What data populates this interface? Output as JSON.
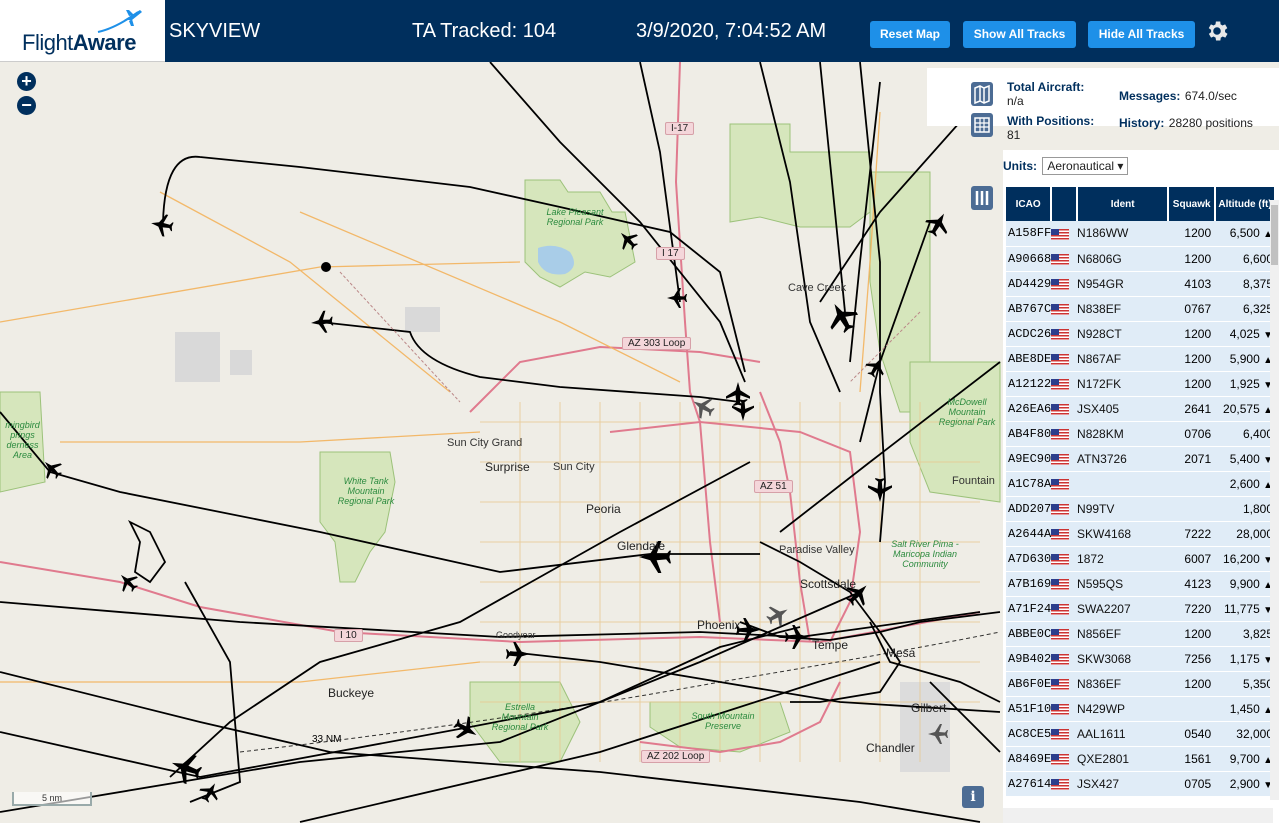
{
  "header": {
    "logo_text_light": "Flight",
    "logo_text_bold": "Aware",
    "title": "SKYVIEW",
    "tracked": "TA Tracked: 104",
    "datetime": "3/9/2020, 7:04:52 AM",
    "buttons": {
      "reset": "Reset Map",
      "show_all": "Show All Tracks",
      "hide_all": "Hide All Tracks"
    }
  },
  "map": {
    "zoom_in": "+",
    "zoom_out": "−",
    "scale": "5 nm",
    "range_ring": "33 NM",
    "labels": {
      "cave_creek": "Cave Creek",
      "sun_city_grand": "Sun City Grand",
      "surprise": "Surprise",
      "sun_city": "Sun City",
      "peoria": "Peoria",
      "glendale": "Glendale",
      "paradise_valley": "Paradise Valley",
      "scottsdale": "Scottsdale",
      "phoenix": "Phoenix",
      "tempe": "Tempe",
      "mesa": "Mesa",
      "goodyear": "Goodyear",
      "buckeye": "Buckeye",
      "gilbert": "Gilbert",
      "chandler": "Chandler",
      "fountain": "Fountain"
    },
    "parks": {
      "lake_pleasant": "Lake Pleasant Regional Park",
      "white_tank": "White Tank Mountain Regional Park",
      "mcdowell": "McDowell Mountain Regional Park",
      "estrella": "Estrella Mountain Regional Park",
      "south_mountain": "South Mountain Preserve",
      "salt_river": "Salt River Pima - Maricopa Indian Community",
      "hummingbird": "mingbird prings derness Area"
    },
    "roads": {
      "i17_top": "I-17",
      "i17": "I 17",
      "az303": "AZ 303 Loop",
      "az51": "AZ 51",
      "i10": "I 10",
      "az202": "AZ 202 Loop"
    }
  },
  "stats": {
    "total_aircraft_label": "Total Aircraft:",
    "total_aircraft_value": "n/a",
    "with_positions_label": "With Positions:",
    "with_positions_value": "81",
    "messages_label": "Messages:",
    "messages_value": "674.0/sec",
    "history_label": "History:",
    "history_value": "28280 positions"
  },
  "table": {
    "units_label": "Units:",
    "units_value": "Aeronautical",
    "columns": [
      "ICAO",
      "",
      "Ident",
      "Squawk",
      "Altitude (ft)"
    ],
    "rows": [
      {
        "icao": "A158FF",
        "ident": "N186WW",
        "squawk": "1200",
        "alt": "6,500",
        "trend": "▲"
      },
      {
        "icao": "A90668",
        "ident": "N6806G",
        "squawk": "1200",
        "alt": "6,600",
        "trend": ""
      },
      {
        "icao": "AD4429",
        "ident": "N954GR",
        "squawk": "4103",
        "alt": "8,375",
        "trend": ""
      },
      {
        "icao": "AB767C",
        "ident": "N838EF",
        "squawk": "0767",
        "alt": "6,325",
        "trend": ""
      },
      {
        "icao": "ACDC26",
        "ident": "N928CT",
        "squawk": "1200",
        "alt": "4,025",
        "trend": "▼"
      },
      {
        "icao": "ABE8DE",
        "ident": "N867AF",
        "squawk": "1200",
        "alt": "5,900",
        "trend": "▲"
      },
      {
        "icao": "A12122",
        "ident": "N172FK",
        "squawk": "1200",
        "alt": "1,925",
        "trend": "▼"
      },
      {
        "icao": "A26EA6",
        "ident": "JSX405",
        "squawk": "2641",
        "alt": "20,575",
        "trend": "▲"
      },
      {
        "icao": "AB4F80",
        "ident": "N828KM",
        "squawk": "0706",
        "alt": "6,400",
        "trend": ""
      },
      {
        "icao": "A9EC90",
        "ident": "ATN3726",
        "squawk": "2071",
        "alt": "5,400",
        "trend": "▼"
      },
      {
        "icao": "A1C78A",
        "ident": "",
        "squawk": "",
        "alt": "2,600",
        "trend": "▲"
      },
      {
        "icao": "ADD207",
        "ident": "N99TV",
        "squawk": "",
        "alt": "1,800",
        "trend": ""
      },
      {
        "icao": "A2644A",
        "ident": "SKW4168",
        "squawk": "7222",
        "alt": "28,000",
        "trend": ""
      },
      {
        "icao": "A7D630",
        "ident": "1872",
        "squawk": "6007",
        "alt": "16,200",
        "trend": "▼"
      },
      {
        "icao": "A7B169",
        "ident": "N595QS",
        "squawk": "4123",
        "alt": "9,900",
        "trend": "▲"
      },
      {
        "icao": "A71F24",
        "ident": "SWA2207",
        "squawk": "7220",
        "alt": "11,775",
        "trend": "▼"
      },
      {
        "icao": "ABBE0C",
        "ident": "N856EF",
        "squawk": "1200",
        "alt": "3,825",
        "trend": ""
      },
      {
        "icao": "A9B402",
        "ident": "SKW3068",
        "squawk": "7256",
        "alt": "1,175",
        "trend": "▼"
      },
      {
        "icao": "AB6F0E",
        "ident": "N836EF",
        "squawk": "1200",
        "alt": "5,350",
        "trend": ""
      },
      {
        "icao": "A51F10",
        "ident": "N429WP",
        "squawk": "",
        "alt": "1,450",
        "trend": "▲"
      },
      {
        "icao": "AC8CE5",
        "ident": "AAL1611",
        "squawk": "0540",
        "alt": "32,000",
        "trend": ""
      },
      {
        "icao": "A8469E",
        "ident": "QXE2801",
        "squawk": "1561",
        "alt": "9,700",
        "trend": "▲"
      },
      {
        "icao": "A27614",
        "ident": "JSX427",
        "squawk": "0705",
        "alt": "2,900",
        "trend": "▼"
      }
    ]
  },
  "colors": {
    "header_bg": "#002F5D",
    "button_bg": "#1E90E8",
    "row_bg": "#E0ECF7",
    "map_bg": "#EFEDE6",
    "park_green": "#CFE3B0"
  },
  "icons": [
    "flightaware-logo-plane",
    "gear-icon",
    "zoom-in-icon",
    "zoom-out-icon",
    "map-icon",
    "grid-icon",
    "columns-icon",
    "info-icon",
    "aircraft-icon"
  ]
}
